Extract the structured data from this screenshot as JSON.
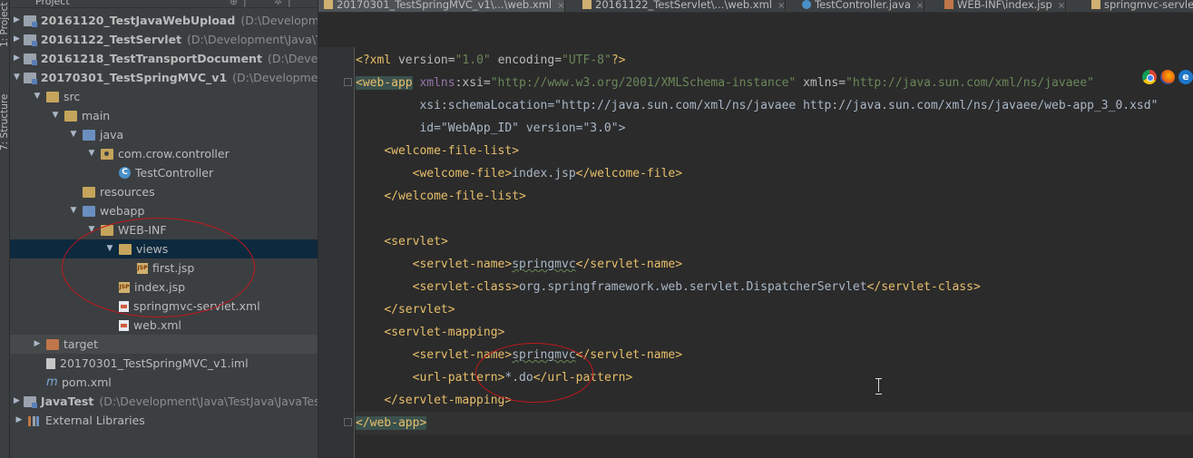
{
  "toolstrip": {
    "project_label": "1: Project",
    "structure_label": "7: Structure"
  },
  "project_panel": {
    "title": "Project",
    "header_icons": [
      "⊕",
      "|",
      "✲",
      "|"
    ],
    "tree": [
      {
        "depth": 0,
        "expanded": false,
        "icon": "module-folder-icon",
        "label": "20161120_TestJavaWebUpload",
        "bold": true,
        "path": "(D:\\Development\\J"
      },
      {
        "depth": 0,
        "expanded": false,
        "icon": "module-folder-icon",
        "label": "20161122_TestServlet",
        "bold": true,
        "path": "(D:\\Development\\Java\\TestJa"
      },
      {
        "depth": 0,
        "expanded": false,
        "icon": "module-folder-icon",
        "label": "20161218_TestTransportDocument",
        "bold": true,
        "path": "(D:\\Developme"
      },
      {
        "depth": 0,
        "expanded": true,
        "icon": "module-folder-icon",
        "label": "20170301_TestSpringMVC_v1",
        "bold": true,
        "path": "(D:\\Development\\Jav"
      },
      {
        "depth": 1,
        "expanded": true,
        "icon": "folder-icon",
        "label": "src"
      },
      {
        "depth": 2,
        "expanded": true,
        "icon": "folder-icon",
        "label": "main"
      },
      {
        "depth": 3,
        "expanded": true,
        "icon": "source-folder-icon",
        "label": "java"
      },
      {
        "depth": 4,
        "expanded": true,
        "icon": "package-icon",
        "label": "com.crow.controller"
      },
      {
        "depth": 5,
        "expanded": null,
        "icon": "class-icon",
        "label": "TestController"
      },
      {
        "depth": 3,
        "expanded": null,
        "icon": "resources-folder-icon",
        "label": "resources"
      },
      {
        "depth": 3,
        "expanded": true,
        "icon": "web-folder-icon",
        "label": "webapp"
      },
      {
        "depth": 4,
        "expanded": true,
        "icon": "folder-icon",
        "label": "WEB-INF"
      },
      {
        "depth": 5,
        "expanded": true,
        "icon": "folder-icon",
        "label": "views",
        "selected": true
      },
      {
        "depth": 6,
        "expanded": null,
        "icon": "jsp-file-icon",
        "label": "first.jsp"
      },
      {
        "depth": 5,
        "expanded": null,
        "icon": "jsp-file-icon",
        "label": "index.jsp"
      },
      {
        "depth": 5,
        "expanded": null,
        "icon": "xml-file-icon",
        "label": "springmvc-servlet.xml"
      },
      {
        "depth": 5,
        "expanded": null,
        "icon": "xml-file-icon",
        "label": "web.xml"
      },
      {
        "depth": 1,
        "expanded": false,
        "icon": "excluded-folder-icon",
        "label": "target",
        "dim": true
      },
      {
        "depth": 1,
        "expanded": null,
        "icon": "iml-file-icon",
        "label": "20170301_TestSpringMVC_v1.iml"
      },
      {
        "depth": 1,
        "expanded": null,
        "icon": "maven-file-icon",
        "label": "pom.xml"
      },
      {
        "depth": 0,
        "expanded": false,
        "icon": "module-folder-icon",
        "label": "JavaTest",
        "bold": true,
        "path": "(D:\\Development\\Java\\TestJava\\JavaTest)"
      },
      {
        "depth": 0,
        "expanded": false,
        "icon": "libraries-icon",
        "label": "External Libraries"
      }
    ]
  },
  "tabs": [
    {
      "label": "20170301_TestSpringMVC_v1\\...\\web.xml",
      "icon": "x",
      "active": true
    },
    {
      "label": "20161122_TestServlet\\...\\web.xml",
      "icon": "x",
      "active": false
    },
    {
      "label": "TestController.java",
      "icon": "c",
      "active": false
    },
    {
      "label": "WEB-INF\\index.jsp",
      "icon": "j",
      "active": false
    },
    {
      "label": "springmvc-servlet",
      "icon": "x",
      "active": false
    }
  ],
  "browsers": [
    "chrome-icon",
    "firefox-icon",
    "ie-icon"
  ],
  "code_lines": [
    "<?xml version=\"1.0\" encoding=\"UTF-8\"?>",
    "<web-app xmlns:xsi=\"http://www.w3.org/2001/XMLSchema-instance\" xmlns=\"http://java.sun.com/xml/ns/javaee\"",
    "         xsi:schemaLocation=\"http://java.sun.com/xml/ns/javaee http://java.sun.com/xml/ns/javaee/web-app_3_0.xsd\"",
    "         id=\"WebApp_ID\" version=\"3.0\">",
    "    <welcome-file-list>",
    "        <welcome-file>index.jsp</welcome-file>",
    "    </welcome-file-list>",
    "",
    "    <servlet>",
    "        <servlet-name>springmvc</servlet-name>",
    "        <servlet-class>org.springframework.web.servlet.DispatcherServlet</servlet-class>",
    "    </servlet>",
    "    <servlet-mapping>",
    "        <servlet-name>springmvc</servlet-name>",
    "        <url-pattern>*.do</url-pattern>",
    "    </servlet-mapping>",
    "</web-app>"
  ],
  "colors": {
    "tag": "#e8bf6a",
    "attribute": "#bababa",
    "namespace": "#9876aa",
    "value": "#6a8759",
    "text": "#a9b7c6",
    "annotation_circle": "#c0171c",
    "selection": "#0d293e"
  }
}
